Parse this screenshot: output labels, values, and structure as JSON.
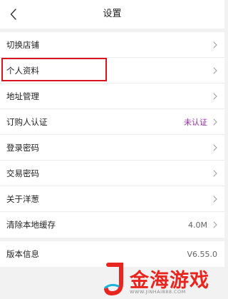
{
  "header": {
    "title": "设置",
    "back_icon": "chevron-left-icon"
  },
  "settings": {
    "items": [
      {
        "label": "切换店铺",
        "value": "",
        "icon": "chevron-right-icon"
      },
      {
        "label": "个人资料",
        "value": "",
        "icon": "chevron-right-icon"
      },
      {
        "label": "地址管理",
        "value": "",
        "icon": "chevron-right-icon"
      },
      {
        "label": "订购人认证",
        "value": "未认证",
        "icon": "chevron-right-icon"
      },
      {
        "label": "登录密码",
        "value": "",
        "icon": "chevron-right-icon"
      },
      {
        "label": "交易密码",
        "value": "",
        "icon": "chevron-right-icon"
      },
      {
        "label": "关于洋葱",
        "value": "",
        "icon": "chevron-right-icon"
      },
      {
        "label": "清除本地缓存",
        "value": "4.0M",
        "icon": "chevron-right-icon"
      }
    ]
  },
  "version": {
    "label": "版本信息",
    "value": "V6.55.0"
  },
  "highlight": {
    "target": "个人资料",
    "color": "#d8161d"
  },
  "watermark": {
    "brand": "金海游戏",
    "url": "WWW.JINHAI888.COM",
    "color": "#e8251f"
  },
  "colors": {
    "background": "#f2f2f2",
    "status_accent": "#9b2fae",
    "divider": "#ececec"
  }
}
